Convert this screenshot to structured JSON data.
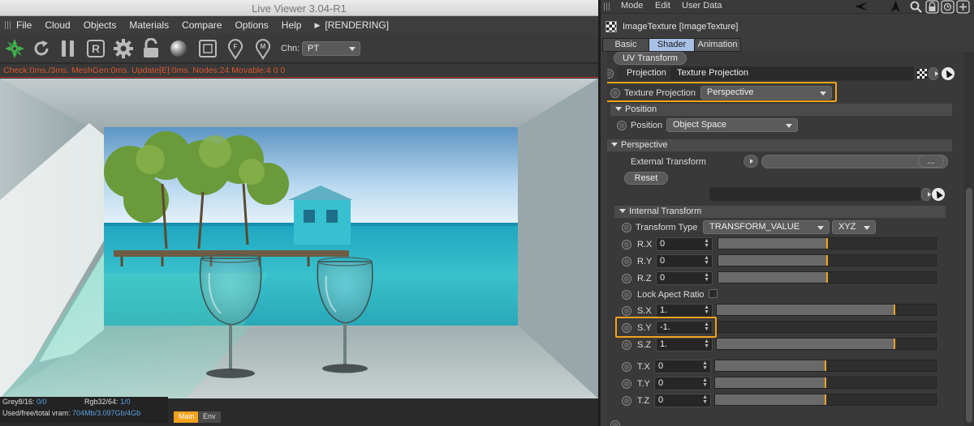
{
  "viewer": {
    "title": "Live Viewer 3.04-R1",
    "menu": [
      "File",
      "Cloud",
      "Objects",
      "Materials",
      "Compare",
      "Options",
      "Help"
    ],
    "status": "[RENDERING]",
    "channel_label": "Chn:",
    "channel_value": "PT",
    "info": "Check:0ms./3ms. MeshGen:0ms. Update[E]:0ms. Nodes:24 Movable:4  0 0",
    "stats": {
      "grey_label": "Grey8/16:",
      "grey_value": "0/0",
      "rgb_label": "Rgb32/64:",
      "rgb_value": "1/0",
      "vram_label": "Used/free/total vram:",
      "vram_value": "704Mb/3.097Gb/4Gb"
    },
    "tabs": [
      "Main",
      "Env"
    ]
  },
  "attr": {
    "menu": [
      "Mode",
      "Edit",
      "User Data"
    ],
    "object_name": "ImageTexture [ImageTexture]",
    "tabs": [
      "Basic",
      "Shader",
      "Animation"
    ],
    "uv_transform_label": "UV Transform",
    "projection_label": "Projection",
    "projection_value": "Texture Projection",
    "texture_projection_label": "Texture Projection",
    "texture_projection_value": "Perspective",
    "position_group": "Position",
    "position_label": "Position",
    "position_value": "Object Space",
    "perspective_group": "Perspective",
    "external_transform_label": "External Transform",
    "ellipsis_label": "...",
    "reset_label": "Reset",
    "internal_transform_group": "Internal Transform",
    "transform_type_label": "Transform Type",
    "transform_type_value": "TRANSFORM_VALUE",
    "rotation_order_value": "XYZ",
    "lock_aspect_label": "Lock Apect Ratio",
    "fields": {
      "rx": {
        "label": "R.X",
        "value": "0",
        "level": 0.5
      },
      "ry": {
        "label": "R.Y",
        "value": "0",
        "level": 0.5
      },
      "rz": {
        "label": "R.Z",
        "value": "0",
        "level": 0.5
      },
      "sx": {
        "label": "S.X",
        "value": "1.",
        "level": 0.81
      },
      "sy": {
        "label": "S.Y",
        "value": "-1.",
        "level": 0
      },
      "sz": {
        "label": "S.Z",
        "value": "1.",
        "level": 0.81
      },
      "tx": {
        "label": "T.X",
        "value": "0",
        "level": 0.5
      },
      "ty": {
        "label": "T.Y",
        "value": "0",
        "level": 0.5
      },
      "tz": {
        "label": "T.Z",
        "value": "0",
        "level": 0.5
      }
    },
    "colors": {
      "highlight": "#f3a21e",
      "active_tab": "#a9c0e6",
      "info_text": "#d9582d",
      "stats_value": "#5aa0e0"
    }
  }
}
